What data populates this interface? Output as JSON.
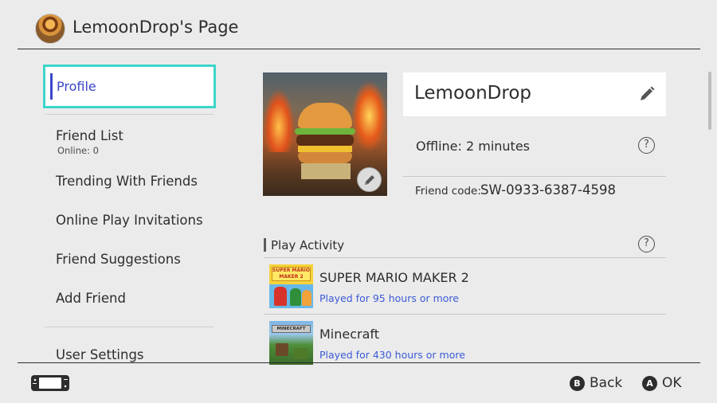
{
  "header": {
    "title": "LemoonDrop's Page",
    "avatar_icon": "burger-avatar"
  },
  "sidebar": {
    "items": [
      {
        "label": "Profile",
        "selected": true
      },
      {
        "label": "Friend List",
        "sublabel": "Online: 0"
      },
      {
        "label": "Trending With Friends"
      },
      {
        "label": "Online Play Invitations"
      },
      {
        "label": "Friend Suggestions"
      },
      {
        "label": "Add Friend"
      },
      {
        "label": "User Settings"
      }
    ]
  },
  "profile": {
    "name": "LemoonDrop",
    "status": "Offline: 2 minutes",
    "friend_code_label": "Friend code:",
    "friend_code": "SW-0933-6387-4598"
  },
  "play_activity": {
    "title": "Play Activity",
    "games": [
      {
        "title": "SUPER MARIO MAKER 2",
        "played": "Played for 95 hours or more",
        "thumb_logo": "SUPER MARIO MAKER 2"
      },
      {
        "title": "Minecraft",
        "played": "Played for 430 hours or more",
        "thumb_logo": "MINECRAFT"
      }
    ]
  },
  "footer": {
    "back_key": "B",
    "back_label": "Back",
    "ok_key": "A",
    "ok_label": "OK"
  },
  "colors": {
    "accent": "#3b47c8",
    "selection_border": "#3dd5c9",
    "link": "#3b5bd6",
    "background": "#ebebeb"
  }
}
